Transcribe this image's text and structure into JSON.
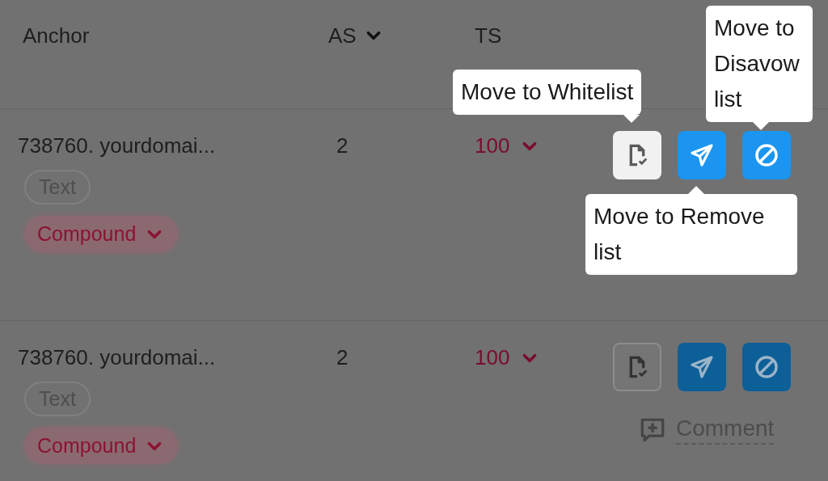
{
  "columns": [
    {
      "label": "Anchor"
    },
    {
      "label": "AS",
      "sortable": true
    },
    {
      "label": "TS"
    }
  ],
  "rows": [
    {
      "anchor": "738760. yourdomai...",
      "as": "2",
      "ts": "100",
      "tags": [
        {
          "label": "Text",
          "kind": "plain"
        },
        {
          "label": "Compound",
          "kind": "dropdown"
        }
      ],
      "highlighted": true,
      "comment": null,
      "actions": [
        {
          "kind": "whitelist"
        },
        {
          "kind": "remove"
        },
        {
          "kind": "disavow"
        }
      ],
      "tooltips": [
        {
          "kind": "whitelist",
          "text": "Move to Whitelist"
        },
        {
          "kind": "disavow",
          "text": "Move to Disavow list"
        },
        {
          "kind": "remove",
          "text": "Move to Remove list"
        }
      ]
    },
    {
      "anchor": "738760. yourdomai...",
      "as": "2",
      "ts": "100",
      "tags": [
        {
          "label": "Text",
          "kind": "plain"
        },
        {
          "label": "Compound",
          "kind": "dropdown"
        }
      ],
      "highlighted": false,
      "comment": "Comment",
      "actions": [
        {
          "kind": "whitelist"
        },
        {
          "kind": "remove"
        },
        {
          "kind": "disavow"
        }
      ]
    }
  ]
}
